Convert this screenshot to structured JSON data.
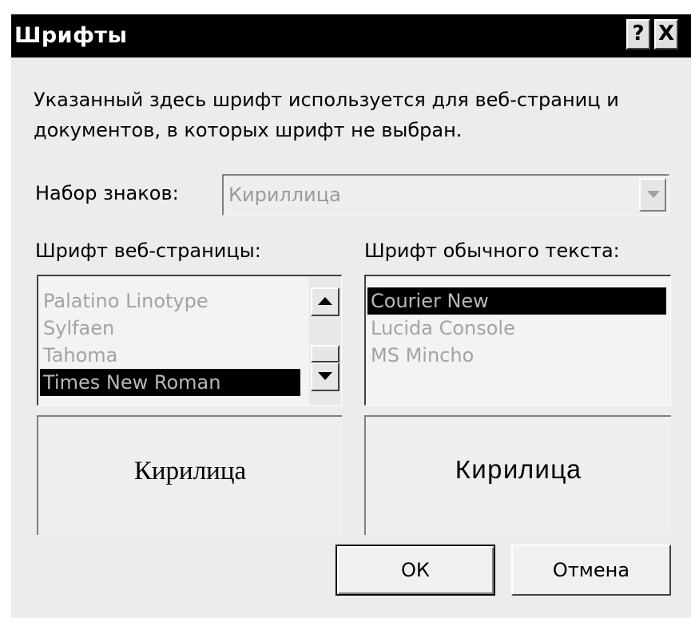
{
  "window": {
    "title": "Шрифты",
    "help_label": "?",
    "close_label": "X"
  },
  "description": {
    "line1": "Указанный здесь шрифт используется для веб-страниц и",
    "line2": "документов, в которых шрифт не выбран."
  },
  "charset": {
    "label": "Набор знаков:",
    "value": "Кириллица",
    "enabled": false
  },
  "web_font": {
    "label": "Шрифт веб-страницы:",
    "items": [
      "Palatino Linotype",
      "Sylfaen",
      "Tahoma",
      "Times New Roman"
    ],
    "selected": "Times New Roman",
    "preview": "Кирилица"
  },
  "plain_font": {
    "label": "Шрифт обычного текста:",
    "items": [
      "Courier New",
      "Lucida Console",
      "MS Mincho"
    ],
    "selected": "Courier New",
    "preview": "Кирилица"
  },
  "buttons": {
    "ok": "ОК",
    "cancel": "Отмена"
  },
  "colors": {
    "titlebar": "#000000",
    "dialog_bg": "#ececec",
    "selection": "#000000",
    "disabled_text": "#a3a3a3"
  }
}
